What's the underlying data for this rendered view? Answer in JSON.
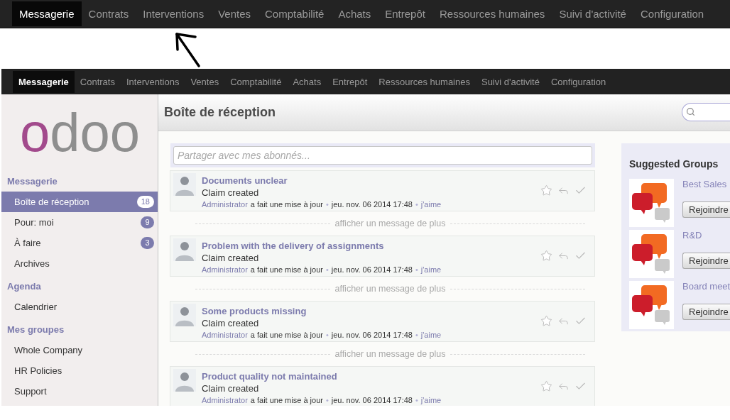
{
  "zoomed_menu": {
    "items": [
      {
        "label": "Messagerie",
        "selected": true
      },
      {
        "label": "Contrats",
        "selected": false
      },
      {
        "label": "Interventions",
        "selected": false
      },
      {
        "label": "Ventes",
        "selected": false
      },
      {
        "label": "Comptabilité",
        "selected": false
      },
      {
        "label": "Achats",
        "selected": false
      },
      {
        "label": "Entrepôt",
        "selected": false
      },
      {
        "label": "Ressources humaines",
        "selected": false
      },
      {
        "label": "Suivi d'activité",
        "selected": false
      },
      {
        "label": "Configuration",
        "selected": false
      }
    ]
  },
  "app": {
    "menu": {
      "items": [
        {
          "label": "Messagerie",
          "selected": true
        },
        {
          "label": "Contrats",
          "selected": false
        },
        {
          "label": "Interventions",
          "selected": false
        },
        {
          "label": "Ventes",
          "selected": false
        },
        {
          "label": "Comptabilité",
          "selected": false
        },
        {
          "label": "Achats",
          "selected": false
        },
        {
          "label": "Entrepôt",
          "selected": false
        },
        {
          "label": "Ressources humaines",
          "selected": false
        },
        {
          "label": "Suivi d'activité",
          "selected": false
        },
        {
          "label": "Configuration",
          "selected": false
        }
      ]
    },
    "sidebar": {
      "logo": [
        {
          "text": "o",
          "color": "#a24a8c"
        },
        {
          "text": "doo",
          "color": "#8e8e8e"
        }
      ],
      "sections": [
        {
          "title": "Messagerie",
          "items": [
            {
              "label": "Boîte de réception",
              "badge": "18",
              "selected": true
            },
            {
              "label": "Pour: moi",
              "badge": "9",
              "selected": false
            },
            {
              "label": "À faire",
              "badge": "3",
              "selected": false
            },
            {
              "label": "Archives",
              "selected": false
            }
          ]
        },
        {
          "title": "Agenda",
          "items": [
            {
              "label": "Calendrier",
              "selected": false
            }
          ]
        },
        {
          "title": "Mes groupes",
          "items": [
            {
              "label": "Whole Company",
              "selected": false
            },
            {
              "label": "HR Policies",
              "selected": false
            },
            {
              "label": "Support",
              "selected": false
            }
          ]
        }
      ]
    },
    "header": {
      "title": "Boîte de réception"
    },
    "composer": {
      "placeholder": "Partager avec mes abonnés..."
    },
    "feed": [
      {
        "kind": "message",
        "title": "Documents unclear",
        "body": "Claim created",
        "author": "Administrator",
        "action": "a fait une mise à jour",
        "separator_1": "•",
        "date": "jeu. nov. 06 2014 17:48",
        "separator_2": "•",
        "like": "j'aime",
        "starred": false
      },
      {
        "kind": "expander",
        "label": "afficher un message de plus"
      },
      {
        "kind": "message",
        "title": "Problem with the delivery of assignments",
        "body": "Claim created",
        "author": "Administrator",
        "action": "a fait une mise à jour",
        "separator_1": "•",
        "date": "jeu. nov. 06 2014 17:48",
        "separator_2": "•",
        "like": "j'aime",
        "starred": false
      },
      {
        "kind": "expander",
        "label": "afficher un message de plus"
      },
      {
        "kind": "message",
        "title": "Some products missing",
        "body": "Claim created",
        "author": "Administrator",
        "action": "a fait une mise à jour",
        "separator_1": "•",
        "date": "jeu. nov. 06 2014 17:48",
        "separator_2": "•",
        "like": "j'aime",
        "starred": false
      },
      {
        "kind": "expander",
        "label": "afficher un message de plus"
      },
      {
        "kind": "message",
        "title": "Product quality not maintained",
        "body": "Claim created",
        "author": "Administrator",
        "action": "a fait une mise à jour",
        "separator_1": "•",
        "date": "jeu. nov. 06 2014 17:48",
        "separator_2": "•",
        "like": "j'aime",
        "starred": false
      }
    ],
    "suggested_groups": {
      "title": "Suggested Groups",
      "groups": [
        {
          "name": "Best Sales",
          "button": "Rejoindre"
        },
        {
          "name": "R&D",
          "button": "Rejoindre"
        },
        {
          "name": "Board meet",
          "button": "Rejoindre"
        }
      ]
    }
  }
}
